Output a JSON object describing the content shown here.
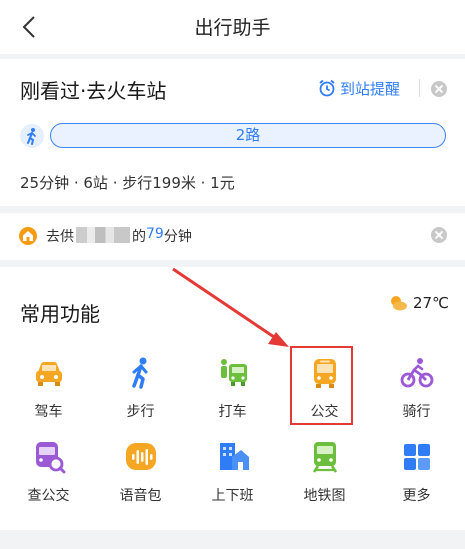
{
  "header": {
    "title": "出行助手",
    "back_icon": "chevron-left-icon"
  },
  "recent": {
    "title": "刚看过·去火车站",
    "remind_label": "到站提醒",
    "route": "2路",
    "meta": "25分钟 · 6站 · 步行199米 · 1元"
  },
  "home": {
    "prefix": "去供",
    "suffix": "的",
    "minutes": "79",
    "unit": "分钟"
  },
  "features": {
    "title": "常用功能",
    "temperature": "27℃",
    "items": [
      {
        "label": "驾车",
        "icon": "car-icon"
      },
      {
        "label": "步行",
        "icon": "walk-icon"
      },
      {
        "label": "打车",
        "icon": "taxi-icon"
      },
      {
        "label": "公交",
        "icon": "bus-icon"
      },
      {
        "label": "骑行",
        "icon": "bike-icon"
      },
      {
        "label": "查公交",
        "icon": "bus-search-icon"
      },
      {
        "label": "语音包",
        "icon": "voice-pack-icon"
      },
      {
        "label": "上下班",
        "icon": "commute-icon"
      },
      {
        "label": "地铁图",
        "icon": "subway-icon"
      },
      {
        "label": "更多",
        "icon": "more-grid-icon"
      }
    ]
  },
  "colors": {
    "accent": "#2f7df6",
    "highlight": "#e53935",
    "background": "#f2f3f5"
  }
}
